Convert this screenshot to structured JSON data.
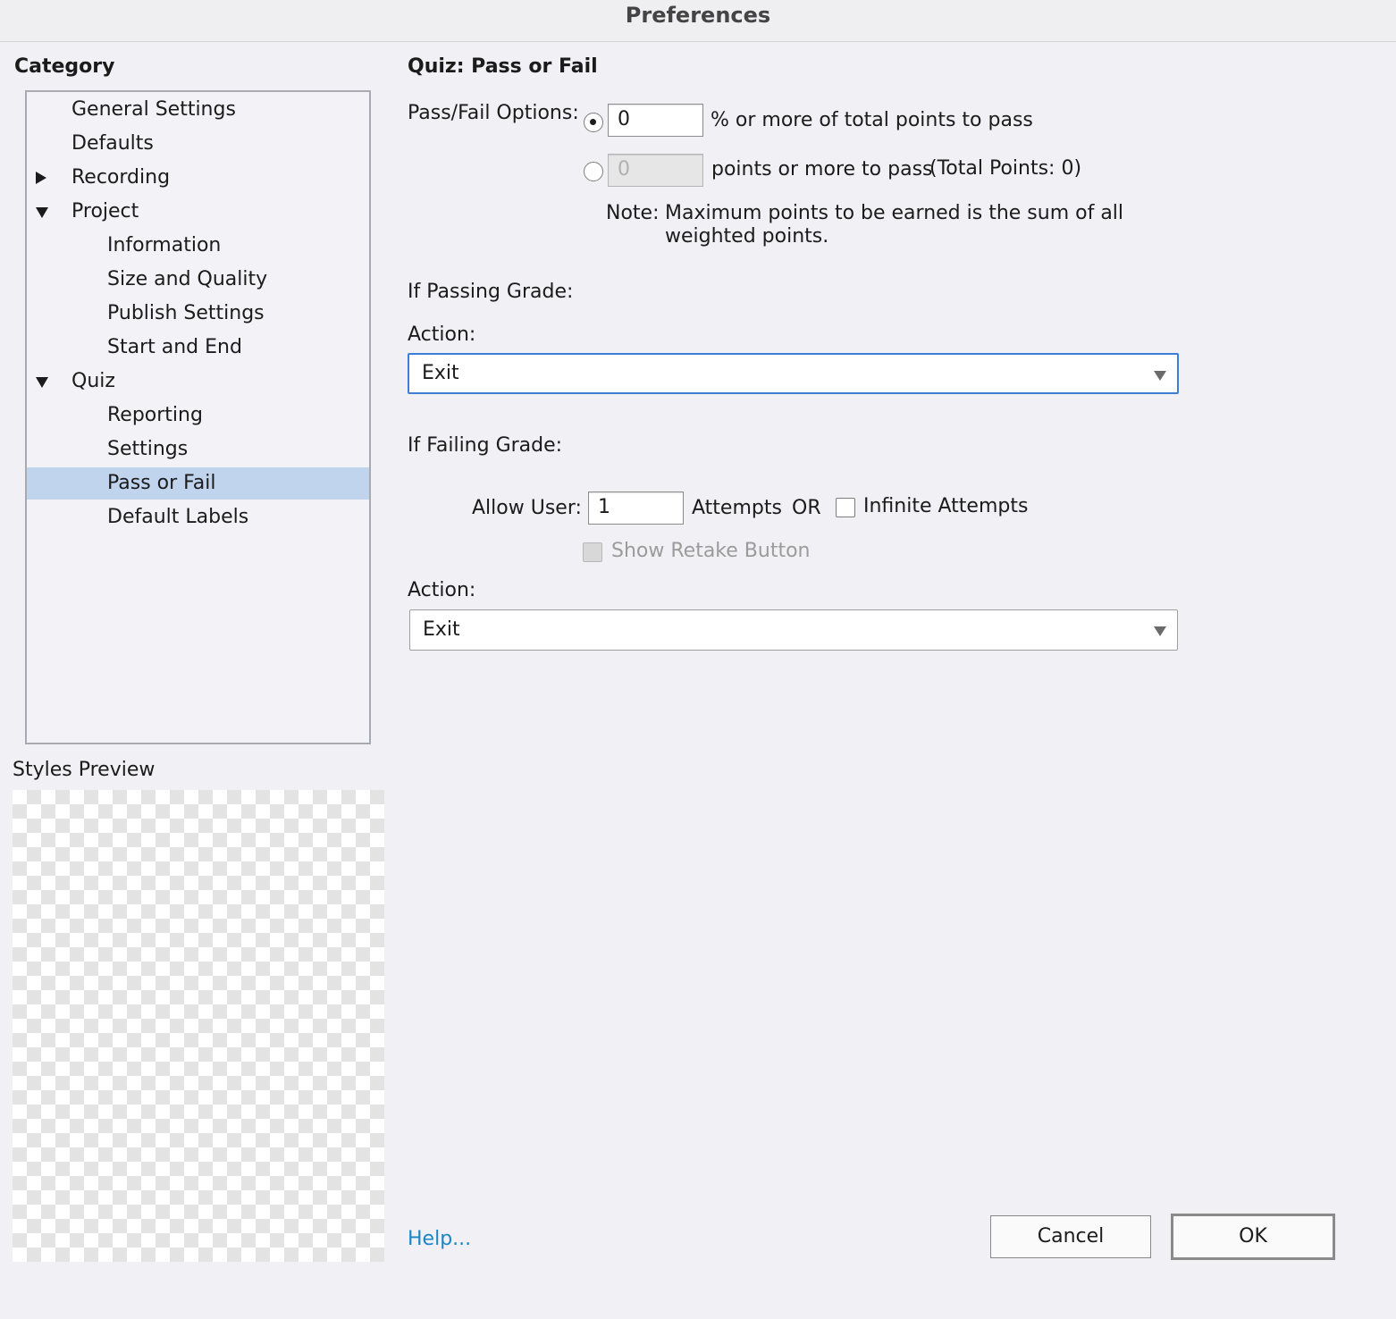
{
  "window": {
    "title": "Preferences"
  },
  "sidebar": {
    "heading": "Category",
    "items": [
      {
        "label": "General Settings"
      },
      {
        "label": "Defaults"
      },
      {
        "label": "Recording"
      },
      {
        "label": "Project"
      },
      {
        "label": "Information"
      },
      {
        "label": "Size and Quality"
      },
      {
        "label": "Publish Settings"
      },
      {
        "label": "Start and End"
      },
      {
        "label": "Quiz"
      },
      {
        "label": "Reporting"
      },
      {
        "label": "Settings"
      },
      {
        "label": "Pass or Fail",
        "selected": true
      },
      {
        "label": "Default Labels"
      }
    ],
    "preview_label": "Styles Preview"
  },
  "main": {
    "title": "Quiz: Pass or Fail",
    "pass_fail_label": "Pass/Fail Options:",
    "percent_option": {
      "value": "0",
      "suffix": "% or more of total points to pass",
      "checked": true
    },
    "points_option": {
      "value": "0",
      "suffix": "points or more to pass",
      "total": "(Total Points: 0)",
      "checked": false
    },
    "note_label": "Note:",
    "note_line1": "Maximum points to be earned is the sum of all",
    "note_line2": "weighted points.",
    "passing": {
      "heading": "If Passing Grade:",
      "action_label": "Action:",
      "action_value": "Exit"
    },
    "failing": {
      "heading": "If Failing Grade:",
      "allow_user_label": "Allow User:",
      "attempts_value": "1",
      "attempts_label": "Attempts",
      "or_label": "OR",
      "infinite_label": "Infinite Attempts",
      "retake_label": "Show Retake Button",
      "action_label": "Action:",
      "action_value": "Exit"
    }
  },
  "footer": {
    "help": "Help...",
    "cancel": "Cancel",
    "ok": "OK"
  },
  "colors": {
    "selection": "#c1d4ee",
    "focus": "#3d7fd8",
    "link": "#1b86c7"
  }
}
